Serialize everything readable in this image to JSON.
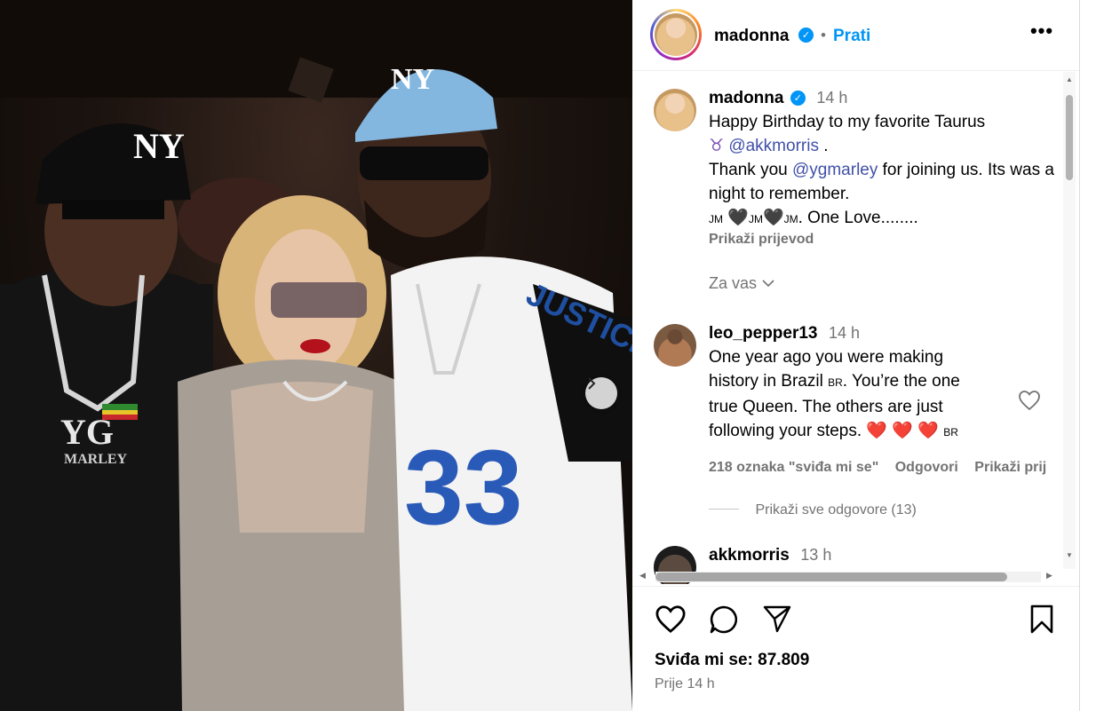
{
  "header": {
    "username": "madonna",
    "separator": "•",
    "follow_label": "Prati",
    "more_label": "•••"
  },
  "caption": {
    "username": "madonna",
    "time": "14 h",
    "line1": "Happy Birthday to my favorite Taurus",
    "taurus_symbol": "♉",
    "mention1": "@akkmorris",
    "line2_end": " .",
    "thank_prefix": "Thank you ",
    "mention2": "@ygmarley",
    "thank_suffix": " for joining us. Its was a night to remember.",
    "jm1": "JM",
    "jm2": "JM",
    "jm3": "JM",
    "one_love": ". One Love........",
    "translate_label": "Prikaži prijevod",
    "for_you_label": "Za vas"
  },
  "comments": [
    {
      "username": "leo_pepper13",
      "time": "14 h",
      "text_a": "One year ago you were making history in Brazil ",
      "flag1": "BR",
      "text_b": ". You’re the one true Queen. The others are just following your steps. ",
      "hearts": "❤️ ❤️ ❤️",
      "flag2": "BR",
      "likes_label": "218 oznaka \"sviđa mi se\"",
      "reply_label": "Odgovori",
      "translate_label": "Prikaži prij",
      "view_replies_label": "Prikaži sve odgovore (13)"
    },
    {
      "username": "akkmorris",
      "time": "13 h"
    }
  ],
  "footer": {
    "likes_text": "Sviđa mi se: 87.809",
    "posted_time": "Prije 14 h"
  },
  "icons": {
    "verified": "✓",
    "chevron": "chevron-down-icon",
    "carousel": "chevron-right-icon"
  },
  "colors": {
    "link_blue": "#0095f6",
    "mention": "#4050a8",
    "heart_red": "#e0245e",
    "muted": "#737373"
  }
}
